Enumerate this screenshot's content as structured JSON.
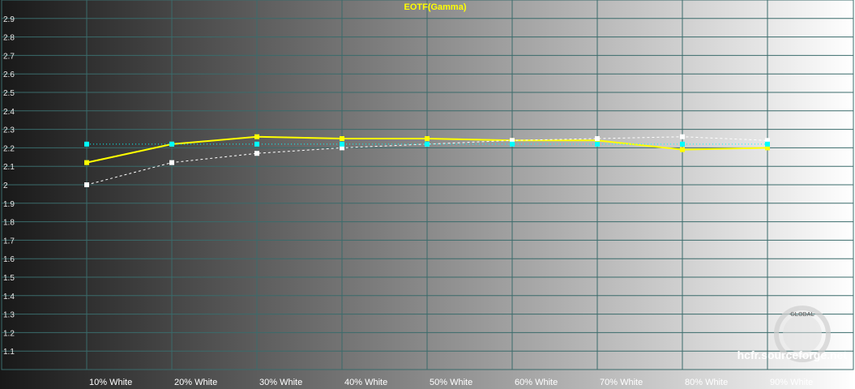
{
  "chart_data": {
    "type": "line",
    "title": "EOTF(Gamma)",
    "xlabel": "",
    "ylabel": "",
    "categories": [
      "10% White",
      "20% White",
      "30% White",
      "40% White",
      "50% White",
      "60% White",
      "70% White",
      "80% White",
      "90% White"
    ],
    "y_ticks": [
      "1.1",
      "1.2",
      "1.3",
      "1.4",
      "1.5",
      "1.6",
      "1.7",
      "1.8",
      "1.9",
      "2",
      "2.1",
      "2.2",
      "2.3",
      "2.4",
      "2.5",
      "2.6",
      "2.7",
      "2.8",
      "2.9"
    ],
    "ylim": [
      1.0,
      3.0
    ],
    "grid": true,
    "legend": "none",
    "series": [
      {
        "values": [
          2.12,
          2.22,
          2.26,
          2.25,
          2.25,
          2.24,
          2.24,
          2.19,
          2.2
        ],
        "color": "#ffff00",
        "style": "solid",
        "marker": "square"
      },
      {
        "values": [
          2.0,
          2.12,
          2.17,
          2.2,
          2.22,
          2.24,
          2.25,
          2.26,
          2.24
        ],
        "color": "#ffffff",
        "style": "dashed",
        "marker": "square"
      },
      {
        "values": [
          2.22,
          2.22,
          2.22,
          2.22,
          2.22,
          2.22,
          2.22,
          2.22,
          2.22
        ],
        "color": "#00ffff",
        "style": "dotted",
        "marker": "square"
      }
    ]
  },
  "colors": {
    "title": "#ffff00",
    "grid": "#3a6b6b",
    "series_yellow": "#ffff00",
    "series_white": "#ffffff",
    "series_cyan": "#00ffff"
  },
  "watermark": {
    "text": "hcfr.sourceforge.net",
    "logo_text": "GLOBAL"
  }
}
